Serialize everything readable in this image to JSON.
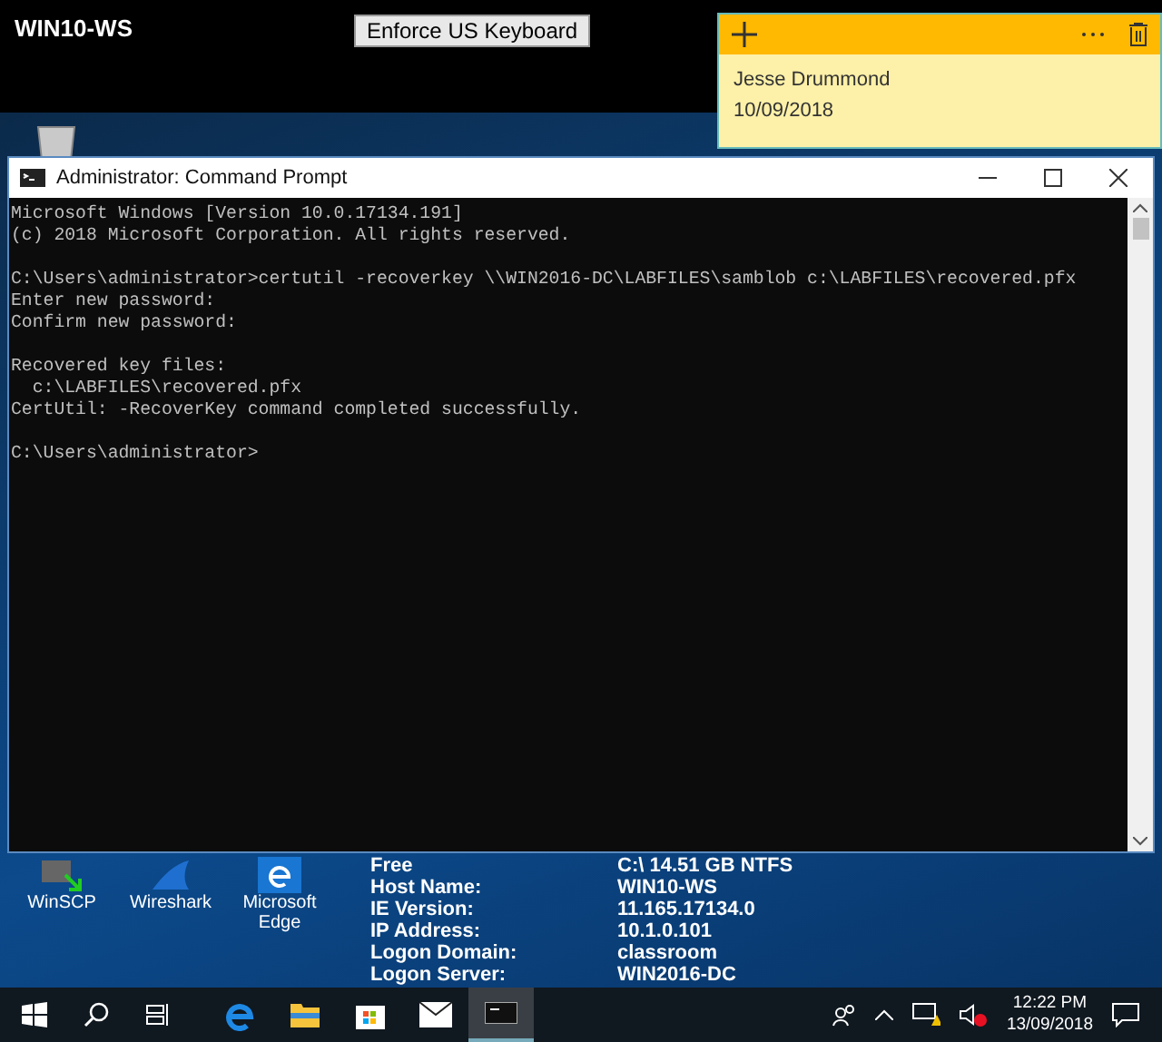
{
  "top_bar": {
    "host": "WIN10-WS",
    "keyboard_button": "Enforce US Keyboard"
  },
  "sticky_note": {
    "lines": [
      "Jesse Drummond",
      "10/09/2018"
    ]
  },
  "console": {
    "title": "Administrator: Command Prompt",
    "blocks": [
      [
        "Microsoft Windows [Version 10.0.17134.191]",
        "(c) 2018 Microsoft Corporation. All rights reserved."
      ],
      [
        "C:\\Users\\administrator>certutil -recoverkey \\\\WIN2016-DC\\LABFILES\\samblob c:\\LABFILES\\recovered.pfx",
        "Enter new password:",
        "Confirm new password:"
      ],
      [
        "Recovered key files:",
        "  c:\\LABFILES\\recovered.pfx",
        "CertUtil: -RecoverKey command completed successfully."
      ],
      [
        "C:\\Users\\administrator>"
      ]
    ]
  },
  "desktop_icons": [
    {
      "label": "WinSCP",
      "kind": "winscp"
    },
    {
      "label": "Wireshark",
      "kind": "wireshark"
    },
    {
      "label": "Microsoft Edge",
      "kind": "edge"
    }
  ],
  "system_info": [
    {
      "label": "Free",
      "value": "C:\\ 14.51 GB NTFS"
    },
    {
      "label": "Host Name:",
      "value": "WIN10-WS"
    },
    {
      "label": "IE Version:",
      "value": "11.165.17134.0"
    },
    {
      "label": "IP Address:",
      "value": "10.1.0.101"
    },
    {
      "label": "Logon Domain:",
      "value": "classroom"
    },
    {
      "label": "Logon Server:",
      "value": "WIN2016-DC"
    }
  ],
  "taskbar": {
    "apps": [
      {
        "kind": "edge",
        "selected": false
      },
      {
        "kind": "explorer",
        "selected": false
      },
      {
        "kind": "store",
        "selected": false
      },
      {
        "kind": "mail",
        "selected": false
      },
      {
        "kind": "console",
        "selected": true
      }
    ],
    "time": "12:22 PM",
    "date": "13/09/2018"
  }
}
